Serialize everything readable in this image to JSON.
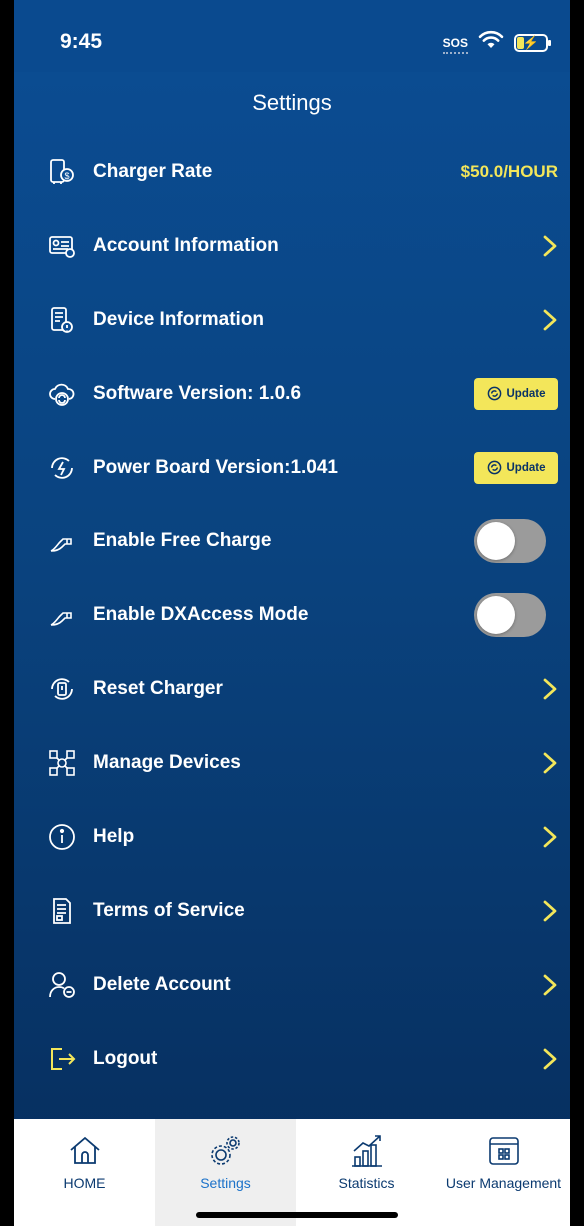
{
  "status_bar": {
    "time": "9:45",
    "sos": "SOS",
    "battery_symbol": "⚡"
  },
  "header": {
    "title": "Settings"
  },
  "colors": {
    "accent": "#f3e65a",
    "background_top": "#0b4d94",
    "background_bottom": "#062d5c",
    "tab_active": "#1c72c9"
  },
  "settings": {
    "charger_rate": {
      "label": "Charger Rate",
      "value": "$50.0/HOUR",
      "icon": "charger-rate-icon"
    },
    "account_information": {
      "label": "Account Information",
      "icon": "account-card-icon"
    },
    "device_information": {
      "label": "Device Information",
      "icon": "device-info-icon"
    },
    "software_version": {
      "label": "Software Version: 1.0.6",
      "button": "Update",
      "icon": "cloud-sync-icon"
    },
    "power_board_version": {
      "label": "Power Board Version:1.041",
      "button": "Update",
      "icon": "power-refresh-icon"
    },
    "free_charge": {
      "label": "Enable Free Charge",
      "enabled": false,
      "icon": "charging-plug-icon"
    },
    "dxaccess_mode": {
      "label": "Enable DXAccess Mode",
      "enabled": false,
      "icon": "charging-plug-icon"
    },
    "reset_charger": {
      "label": "Reset Charger",
      "icon": "reset-charger-icon"
    },
    "manage_devices": {
      "label": "Manage Devices",
      "icon": "devices-network-icon"
    },
    "help": {
      "label": "Help",
      "icon": "info-icon"
    },
    "terms_of_service": {
      "label": "Terms of Service",
      "icon": "document-icon"
    },
    "delete_account": {
      "label": "Delete Account",
      "icon": "user-remove-icon"
    },
    "logout": {
      "label": "Logout",
      "icon": "logout-icon"
    }
  },
  "tab_bar": {
    "tabs": [
      {
        "label": "HOME",
        "icon": "home-icon",
        "active": false
      },
      {
        "label": "Settings",
        "icon": "gears-icon",
        "active": true
      },
      {
        "label": "Statistics",
        "icon": "statistics-icon",
        "active": false
      },
      {
        "label": "User Management",
        "icon": "user-management-icon",
        "active": false
      }
    ]
  }
}
